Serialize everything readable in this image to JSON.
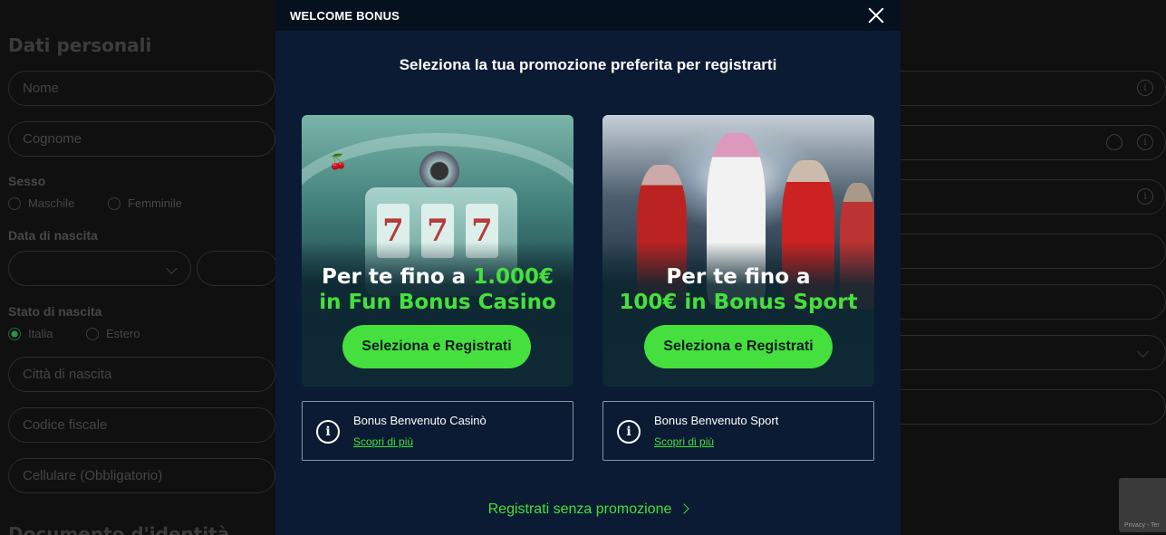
{
  "background_form": {
    "section_title": "Dati personali",
    "fields": {
      "nome": "Nome",
      "cognome": "Cognome",
      "citta_nascita": "Città di nascita",
      "codice_fiscale": "Codice fiscale",
      "cellulare": "Cellulare (Obbligatorio)"
    },
    "labels": {
      "sesso": "Sesso",
      "data_nascita": "Data di nascita",
      "stato_nascita": "Stato di nascita"
    },
    "radios": {
      "maschile": "Maschile",
      "femminile": "Femminile",
      "italia": "Italia",
      "estero": "Estero"
    },
    "next_section_title": "Documento d'identità",
    "recaptcha_text": "Privacy - Ter"
  },
  "modal": {
    "header_title": "WELCOME BONUS",
    "subtitle": "Seleziona la tua promozione preferita per registrarti",
    "cards": [
      {
        "headline_pre": "Per te fino a ",
        "headline_highlight": "1.000€",
        "headline_line2": "in Fun Bonus Casino",
        "button_label": "Seleziona e Registrati",
        "info_title": "Bonus Benvenuto Casinò",
        "info_link": "Scopri di più"
      },
      {
        "headline_pre": "Per te fino a",
        "headline_highlight": "100€ in Bonus Sport",
        "button_label": "Seleziona e Registrati",
        "info_title": "Bonus Benvenuto Sport",
        "info_link": "Scopri di più"
      }
    ],
    "no_promo_link": "Registrati senza promozione"
  },
  "colors": {
    "accent_green": "#45e03d",
    "modal_bg": "#0b1b33",
    "header_bg": "#06111f"
  }
}
